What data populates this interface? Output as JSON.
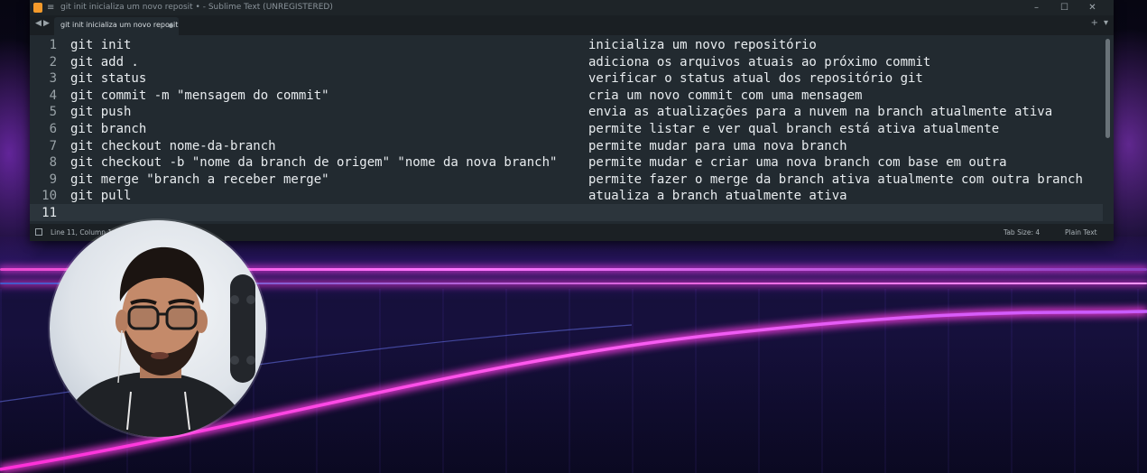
{
  "window": {
    "title": "git init inicializa um novo reposit • - Sublime Text (UNREGISTERED)",
    "controls": [
      "–",
      "☐",
      "✕"
    ]
  },
  "tabs": [
    {
      "label": "git init inicializa um novo reposit",
      "modified": true
    }
  ],
  "editor": {
    "lines": [
      {
        "num": "1",
        "code": "git init",
        "desc": "inicializa um novo repositório"
      },
      {
        "num": "2",
        "code": "git add .",
        "desc": "adiciona os arquivos atuais ao próximo commit"
      },
      {
        "num": "3",
        "code": "git status",
        "desc": "verificar o status atual dos repositório git"
      },
      {
        "num": "4",
        "code": "git commit -m \"mensagem do commit\"",
        "desc": "cria um novo commit com uma mensagem"
      },
      {
        "num": "5",
        "code": "git push",
        "desc": "envia as atualizações para a nuvem na branch atualmente ativa"
      },
      {
        "num": "6",
        "code": "git branch",
        "desc": "permite listar e ver qual branch está ativa atualmente"
      },
      {
        "num": "7",
        "code": "git checkout nome-da-branch",
        "desc": "permite mudar para uma nova branch"
      },
      {
        "num": "8",
        "code": "git checkout -b \"nome da branch de origem\" \"nome da nova branch\"",
        "desc": "permite mudar e criar uma nova branch com base em outra"
      },
      {
        "num": "9",
        "code": "git merge \"branch a receber merge\"",
        "desc": "permite fazer o merge da branch ativa atualmente com outra branch"
      },
      {
        "num": "10",
        "code": "git pull",
        "desc": "atualiza a branch atualmente ativa"
      },
      {
        "num": "11",
        "code": "",
        "desc": ""
      }
    ],
    "current_line": 11
  },
  "statusbar": {
    "position": "Line 11, Column 1",
    "tab_size": "Tab Size: 4",
    "syntax": "Plain Text"
  },
  "icons": {
    "app": "sublime-text-icon",
    "menu": "hamburger-icon",
    "back": "arrow-left-icon",
    "forward": "arrow-right-icon",
    "new_tab": "plus-icon",
    "tab_list": "chevron-down-icon",
    "panel_toggle": "panel-icon"
  },
  "colors": {
    "editor_bg": "#222a30",
    "text": "#e8ecef",
    "gutter_text": "#9aa3a8",
    "neon_pink": "#ff3ce6"
  }
}
